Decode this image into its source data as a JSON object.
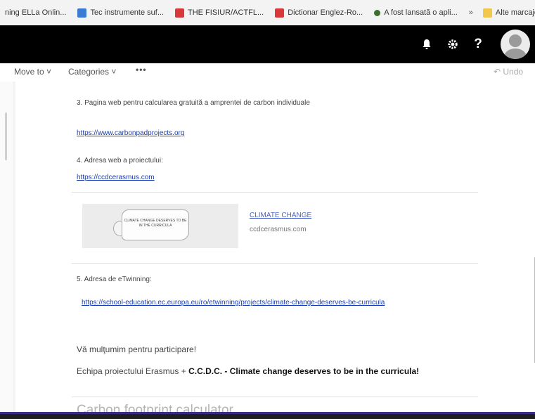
{
  "bookmarks": [
    {
      "label": "ning ELLa Onlin...",
      "icon": "bookmark-icon",
      "color": "#7b5ab0"
    },
    {
      "label": "Tec instrumente suf...",
      "icon": "translate-icon",
      "color": "#3a7bd5"
    },
    {
      "label": "THE FISIUR/ACTFL...",
      "icon": "bookmark-icon",
      "color": "#d9383a"
    },
    {
      "label": "Dictionar Englez-Ro...",
      "icon": "bookmark-icon",
      "color": "#d9383a"
    },
    {
      "label": "A fost lansată o apli...",
      "icon": "bookmark-icon",
      "color": "#3c6e2e"
    }
  ],
  "bookmarks_more": "»",
  "bookmarks_other": "Alte marcaje",
  "topbar": {
    "bell": "bell-icon",
    "gear": "gear-icon",
    "help": "?",
    "avatar": "avatar-icon"
  },
  "commands": {
    "move_to": "Move to ˅",
    "categories": "Categories ˅",
    "more": "•••",
    "undo": "↶ Undo"
  },
  "message": {
    "item3": "3. Pagina web pentru calcularea gratuită a amprentei de carbon individuale",
    "link3": "https://www.carbonpadprojects.org",
    "item4": "4. Adresa web a proiectului:",
    "link4": "https://ccdcerasmus.com",
    "preview": {
      "banner_text": "CLIMATE CHANGE DESERVES TO BE IN THE CURRICULA",
      "title": "CLIMATE CHANGE",
      "domain": "ccdcerasmus.com"
    },
    "item5": "5. Adresa de eTwinning:",
    "link5": "https://school-education.ec.europa.eu/ro/etwinning/projects/climate-change-deserves-be-curricula",
    "thanks": "Vă mulţumim pentru participare!",
    "team_prefix": "Echipa proiectului Erasmus +",
    "team_bold": "C.C.D.C. - Climate change deserves to be in the curricula!",
    "bottom_title": "Carbon footprint calculator"
  },
  "colors": {
    "header": "#000000",
    "link": "#1a3db0",
    "accent": "#3a2a8c"
  }
}
